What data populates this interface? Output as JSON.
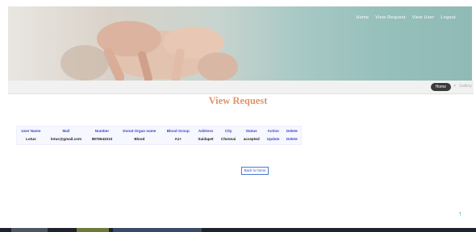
{
  "nav": {
    "items": [
      "Home",
      "View Request",
      "View User",
      "Logout"
    ]
  },
  "breadcrumb": {
    "home": "Home",
    "separator": ">",
    "current": "Gallery"
  },
  "page": {
    "title": "View Request"
  },
  "table": {
    "headers": [
      "User Name",
      "Mail",
      "Number",
      "Donat Organ name",
      "Blood Group",
      "Address",
      "City",
      "Status",
      "Action",
      "Delete"
    ],
    "rows": [
      [
        "Lotus",
        "lotus@gmail.com",
        "9876543210",
        "Blood",
        "A1+",
        "Saidapet",
        "Chennai",
        "accepted",
        "Update",
        "Delete"
      ]
    ]
  },
  "back_button": {
    "label": "Back to home"
  },
  "scroll_top": {
    "icon": "arrow-up-icon"
  },
  "colors": {
    "accent_title": "#e5946a",
    "link": "#3b46c9",
    "nav_text": "#ffffff"
  }
}
